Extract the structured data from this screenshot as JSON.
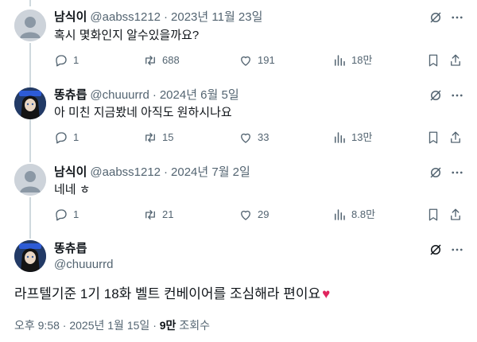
{
  "replies": [
    {
      "name": "남식이",
      "handle": "@aabss1212",
      "date": "2023년 11월 23일",
      "text": "혹시 몇화인지 알수있을까요?",
      "replies": "1",
      "retweets": "688",
      "likes": "191",
      "views": "18만",
      "avatar": "default-avatar"
    },
    {
      "name": "똥츄릅",
      "handle": "@chuuurrd",
      "date": "2024년 6월 5일",
      "text": "아 미친 지금봤네 아직도 원하시나요",
      "replies": "1",
      "retweets": "15",
      "likes": "33",
      "views": "13만",
      "avatar": "anime-avatar"
    },
    {
      "name": "남식이",
      "handle": "@aabss1212",
      "date": "2024년 7월 2일",
      "text": "네네 ㅎ",
      "replies": "1",
      "retweets": "21",
      "likes": "29",
      "views": "8.8만",
      "avatar": "default-avatar"
    }
  ],
  "main": {
    "name": "똥츄릅",
    "handle": "@chuuurrd",
    "text": "라프텔기준 1기 18화 벨트 컨베이어를 조심해라 편이요",
    "heart_emoji": "♥",
    "time": "오후 9:58",
    "date": "2025년 1월 15일",
    "views": "9만",
    "views_label": "조회수",
    "separator": "·"
  },
  "colors": {
    "text": "#0f1419",
    "secondary": "#536471",
    "heart": "#e0245e",
    "thread_line": "#cfd9de"
  }
}
